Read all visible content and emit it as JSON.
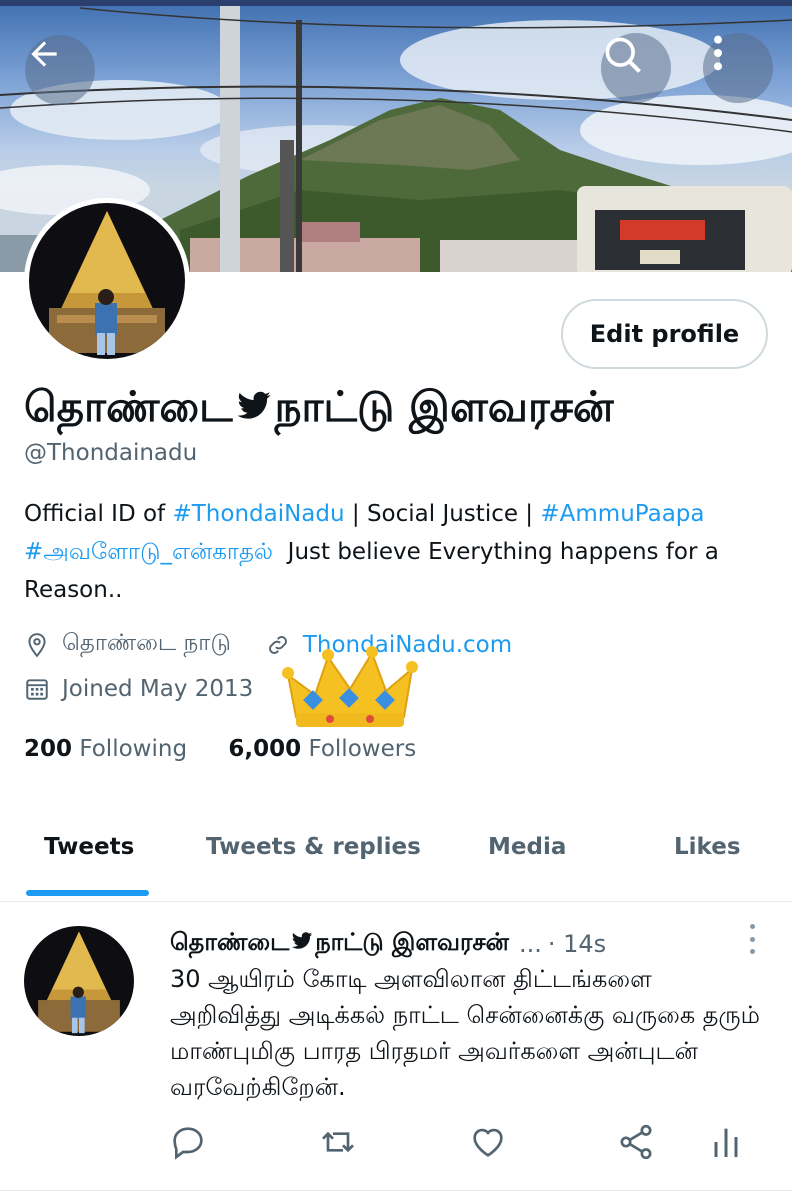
{
  "header": {
    "back_icon": "arrow-left-icon",
    "search_icon": "search-icon",
    "more_icon": "more-vertical-icon"
  },
  "profile": {
    "edit_button": "Edit profile",
    "name_part1": "தொண்டை",
    "name_part2": "நாட்டு இளவரசன்",
    "handle": "@Thondainadu",
    "bio": {
      "t1": "Official ID of ",
      "l1": "#ThondaiNadu",
      "t2": " | Social Justice | ",
      "l2": "#AmmuPaapa",
      "l3": "#அவளோடு_என்காதல்",
      "t3": "Just believe Everything happens for a Reason.."
    },
    "location": "தொண்டை நாடு",
    "website": "ThondaiNadu.com",
    "joined": "Joined May 2013",
    "following_count": "200",
    "following_label": "Following",
    "followers_count": "6,000",
    "followers_label": "Followers"
  },
  "tabs": [
    "Tweets",
    "Tweets & replies",
    "Media",
    "Likes"
  ],
  "tweet": {
    "name_part1": "தொண்டை",
    "name_part2": "நாட்டு இளவரசன்",
    "ellipsis": "...",
    "time": "· 14s",
    "text": "30 ஆயிரம் கோடி அளவிலான திட்டங்களை அறிவித்து அடிக்கல் நாட்ட சென்னைக்கு வருகை தரும் மாண்புமிகு பாரத பிரதமர் அவர்களை அன்புடன் வரவேற்கிறேன்."
  },
  "colors": {
    "accent": "#1d9bf0",
    "text": "#0f1419",
    "muted": "#536471"
  }
}
